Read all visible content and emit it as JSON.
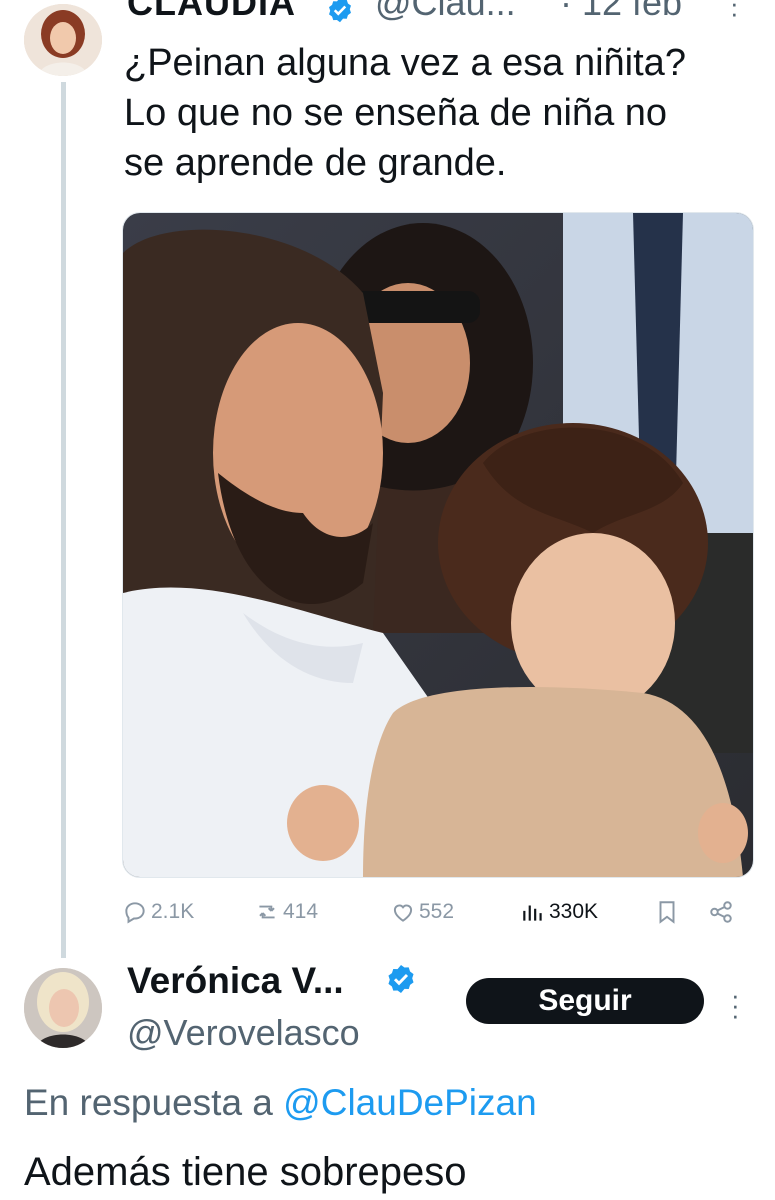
{
  "tweet": {
    "author_name": "CLAUDIA",
    "handle": "@Clau...",
    "date": "· 12 feb",
    "text": "¿Peinan alguna vez a esa niñita?\nLo que no se enseña de niña no\nse aprende de grande.",
    "stats": {
      "replies": "2.1K",
      "retweets": "414",
      "likes": "552",
      "views": "330K"
    }
  },
  "reply": {
    "author_name": "Verónica V...",
    "handle": "@Verovelasco",
    "follow_label": "Seguir",
    "reply_prefix": "En respuesta a",
    "reply_mention": "@ClauDePizan",
    "text": "Además tiene sobrepeso"
  },
  "colors": {
    "accent": "#1d9bf0",
    "text": "#0f1419",
    "muted": "#536471",
    "action_icon": "#8b98a5"
  },
  "icons": [
    "verified-badge-icon",
    "more-options-icon",
    "reply-icon",
    "retweet-icon",
    "like-icon",
    "views-icon",
    "bookmark-icon",
    "share-icon"
  ]
}
